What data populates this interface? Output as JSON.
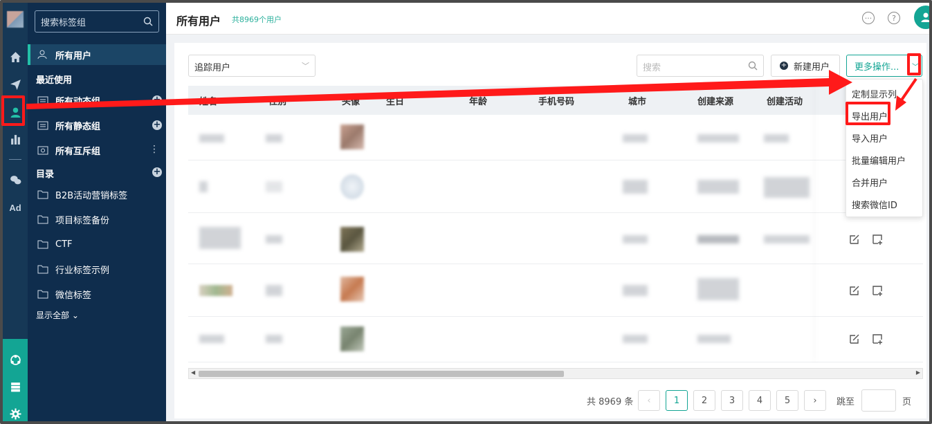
{
  "sidebar": {
    "search_placeholder": "搜索标签组",
    "items": [
      {
        "label": "所有用户"
      },
      {
        "label": "所有动态组"
      },
      {
        "label": "所有静态组"
      },
      {
        "label": "所有互斥组"
      },
      {
        "label": "B2B活动营销标签"
      },
      {
        "label": "项目标签备份"
      },
      {
        "label": "CTF"
      },
      {
        "label": "行业标签示例"
      },
      {
        "label": "微信标签"
      }
    ],
    "recent_heading": "最近使用",
    "catalog_heading": "目录",
    "show_all": "显示全部",
    "plus": "+",
    "kebab": "⋮"
  },
  "rail": {
    "icons": [
      "home-icon",
      "send-icon",
      "user-icon",
      "chart-icon",
      "wechat-icon",
      "ad-icon",
      "hub-icon",
      "server-icon",
      "gear-icon"
    ],
    "ad_label": "Ad"
  },
  "header": {
    "title": "所有用户",
    "count": "共8969个用户",
    "help_glyph": "?"
  },
  "toolbar": {
    "filter_value": "追踪用户",
    "search_placeholder": "搜索",
    "new_user_label": "新建用户",
    "more_label": "更多操作..."
  },
  "table": {
    "columns": [
      "姓名",
      "性别",
      "头像",
      "生日",
      "年龄",
      "手机号码",
      "城市",
      "创建来源",
      "创建活动"
    ]
  },
  "menu": {
    "items": [
      "定制显示列",
      "导出用户",
      "导入用户",
      "批量编辑用户",
      "合并用户",
      "搜索微信ID"
    ]
  },
  "pagination": {
    "total": "共 8969 条",
    "pages": [
      "1",
      "2",
      "3",
      "4",
      "5"
    ],
    "current": "1",
    "jump_label": "跳至",
    "page_label": "页"
  },
  "colors": {
    "accent": "#13a594",
    "sidebar_bg": "#0f2d4d",
    "annotation": "#ff1a1a"
  }
}
